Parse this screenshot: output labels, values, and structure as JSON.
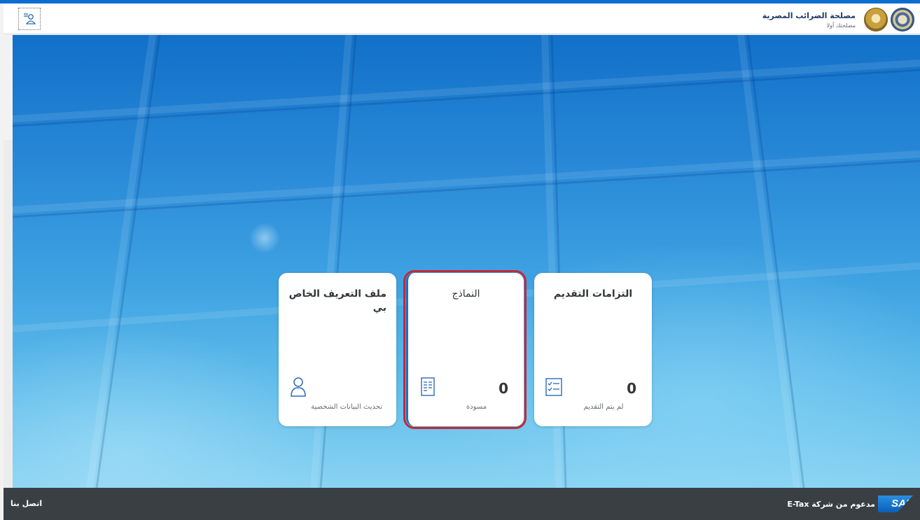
{
  "header": {
    "brand_title": "مصلحة الضرائب المصرية",
    "brand_subtitle": "مصلحتك أولا"
  },
  "tiles": [
    {
      "title": "التزامات التقديم",
      "count": "0",
      "footer": "لم يتم التقديم",
      "icon": "checklist-icon"
    },
    {
      "title": "النماذج",
      "count": "0",
      "footer": "مسودة",
      "icon": "document-icon",
      "selected": true
    },
    {
      "title": "ملف التعريف الخاص بي",
      "footer": "تحديث البيانات الشخصية",
      "icon": "person-icon"
    }
  ],
  "footer": {
    "contact_label": "اتصل بنا",
    "powered_by": "مدعوم من شركة E-Tax",
    "sap_logo": "SAP"
  },
  "colors": {
    "accent": "#0a6ed1",
    "selection_outline": "#c4283a",
    "footer_bg": "#3a3f44",
    "icon": "#2a6ab8"
  }
}
